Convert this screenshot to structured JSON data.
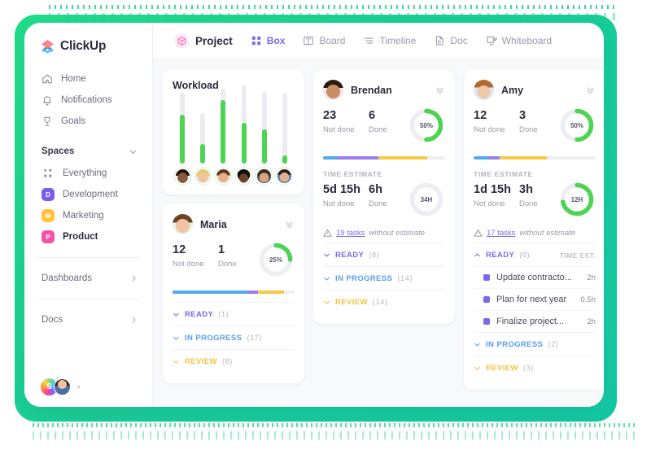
{
  "brand": {
    "name": "ClickUp",
    "accent": "#7b68ee",
    "green": "#4ed452"
  },
  "sidebar": {
    "nav": [
      {
        "label": "Home",
        "icon": "home-icon"
      },
      {
        "label": "Notifications",
        "icon": "bell-icon"
      },
      {
        "label": "Goals",
        "icon": "trophy-icon"
      }
    ],
    "spaces_title": "Spaces",
    "spaces": [
      {
        "label": "Everything",
        "badge": "",
        "color": "",
        "icon": "grid-icon",
        "active": false
      },
      {
        "label": "Development",
        "badge": "D",
        "color": "#7b5cf0",
        "active": false
      },
      {
        "label": "Marketing",
        "badge": "M",
        "color": "#ffc53d",
        "active": false
      },
      {
        "label": "Product",
        "badge": "P",
        "color": "#f451a8",
        "active": true
      }
    ],
    "footer": [
      {
        "label": "Dashboards"
      },
      {
        "label": "Docs"
      }
    ],
    "user_avatar_initial": "S"
  },
  "topbar": {
    "tabs": [
      {
        "label": "Project",
        "icon": "cube-icon",
        "style": "primary"
      },
      {
        "label": "Box",
        "icon": "box-grid-icon",
        "style": "selected"
      },
      {
        "label": "Board",
        "icon": "board-icon",
        "style": "normal"
      },
      {
        "label": "Timeline",
        "icon": "timeline-icon",
        "style": "normal"
      },
      {
        "label": "Doc",
        "icon": "doc-icon",
        "style": "normal"
      },
      {
        "label": "Whiteboard",
        "icon": "whiteboard-icon",
        "style": "normal"
      }
    ]
  },
  "workload": {
    "title": "Workload",
    "bars": [
      {
        "track_h": 88,
        "fill_h": 60,
        "skin": "#8a5a3c",
        "hair": "#241409"
      },
      {
        "track_h": 62,
        "fill_h": 24,
        "skin": "#f0c49a",
        "hair": "#e8c878"
      },
      {
        "track_h": 92,
        "fill_h": 78,
        "skin": "#e8b08a",
        "hair": "#5a3420"
      },
      {
        "track_h": 96,
        "fill_h": 50,
        "skin": "#6b4328",
        "hair": "#12100f"
      },
      {
        "track_h": 88,
        "fill_h": 42,
        "skin": "#d9a483",
        "hair": "#3a2a20"
      },
      {
        "track_h": 86,
        "fill_h": 10,
        "skin": "#e3b193",
        "hair": "#2e2218"
      }
    ]
  },
  "cards": [
    {
      "name": "Brendan",
      "skin": "#c98e63",
      "hair": "#2a1a10",
      "not_done": "23",
      "not_done_label": "Not done",
      "done": "6",
      "done_label": "Done",
      "percent": "50%",
      "percent_arc": 50,
      "bar": [
        {
          "color": "#52a9f0",
          "pct": 12
        },
        {
          "color": "#9b7dee",
          "pct": 33
        },
        {
          "color": "#f7c948",
          "pct": 40
        }
      ],
      "time_label": "TIME ESTIMATE",
      "time_not_done": "5d 15h",
      "time_done": "6h",
      "time_badge": "34H",
      "time_arc": 0,
      "warn_link": "19 tasks",
      "warn_text": "without estimate",
      "groups": [
        {
          "label": "READY",
          "count": "(8)",
          "kind": "ready",
          "open": false
        },
        {
          "label": "IN PROGRESS",
          "count": "(14)",
          "kind": "prog",
          "open": false
        },
        {
          "label": "REVIEW",
          "count": "(14)",
          "kind": "review",
          "open": false
        }
      ],
      "tasks": []
    },
    {
      "name": "Amy",
      "skin": "#f0c8a8",
      "hair": "#b06a2c",
      "not_done": "12",
      "not_done_label": "Not done",
      "done": "3",
      "done_label": "Done",
      "percent": "50%",
      "percent_arc": 50,
      "bar": [
        {
          "color": "#52a9f0",
          "pct": 12
        },
        {
          "color": "#9b7dee",
          "pct": 9
        },
        {
          "color": "#f7c948",
          "pct": 39
        }
      ],
      "time_label": "TIME ESTIMATE",
      "time_not_done": "1d 15h",
      "time_done": "3h",
      "time_badge": "12H",
      "time_arc": 72,
      "warn_link": "17 tasks",
      "warn_text": "without estimate",
      "groups": [
        {
          "label": "READY",
          "count": "(8)",
          "kind": "ready",
          "open": true,
          "time_est_header": "TIME EST."
        },
        {
          "label": "IN PROGRESS",
          "count": "(2)",
          "kind": "prog",
          "open": false
        },
        {
          "label": "REVIEW",
          "count": "(3)",
          "kind": "review",
          "open": false
        }
      ],
      "tasks": [
        {
          "name": "Update contracto...",
          "est": "2h"
        },
        {
          "name": "Plan for next year",
          "est": "0.5h"
        },
        {
          "name": "Finalize project...",
          "est": "2h"
        }
      ]
    },
    {
      "name": "Maria",
      "skin": "#f2c3a4",
      "hair": "#6b4426",
      "not_done": "12",
      "not_done_label": "Not done",
      "done": "1",
      "done_label": "Done",
      "percent": "25%",
      "percent_arc": 25,
      "bar": [
        {
          "color": "#52a9f0",
          "pct": 62
        },
        {
          "color": "#9b7dee",
          "pct": 8
        },
        {
          "color": "#f7c948",
          "pct": 21
        }
      ],
      "groups": [
        {
          "label": "READY",
          "count": "(1)",
          "kind": "ready",
          "open": false
        },
        {
          "label": "IN PROGRESS",
          "count": "(17)",
          "kind": "prog",
          "open": false
        },
        {
          "label": "REVIEW",
          "count": "(8)",
          "kind": "review",
          "open": false
        }
      ],
      "tasks": []
    }
  ]
}
